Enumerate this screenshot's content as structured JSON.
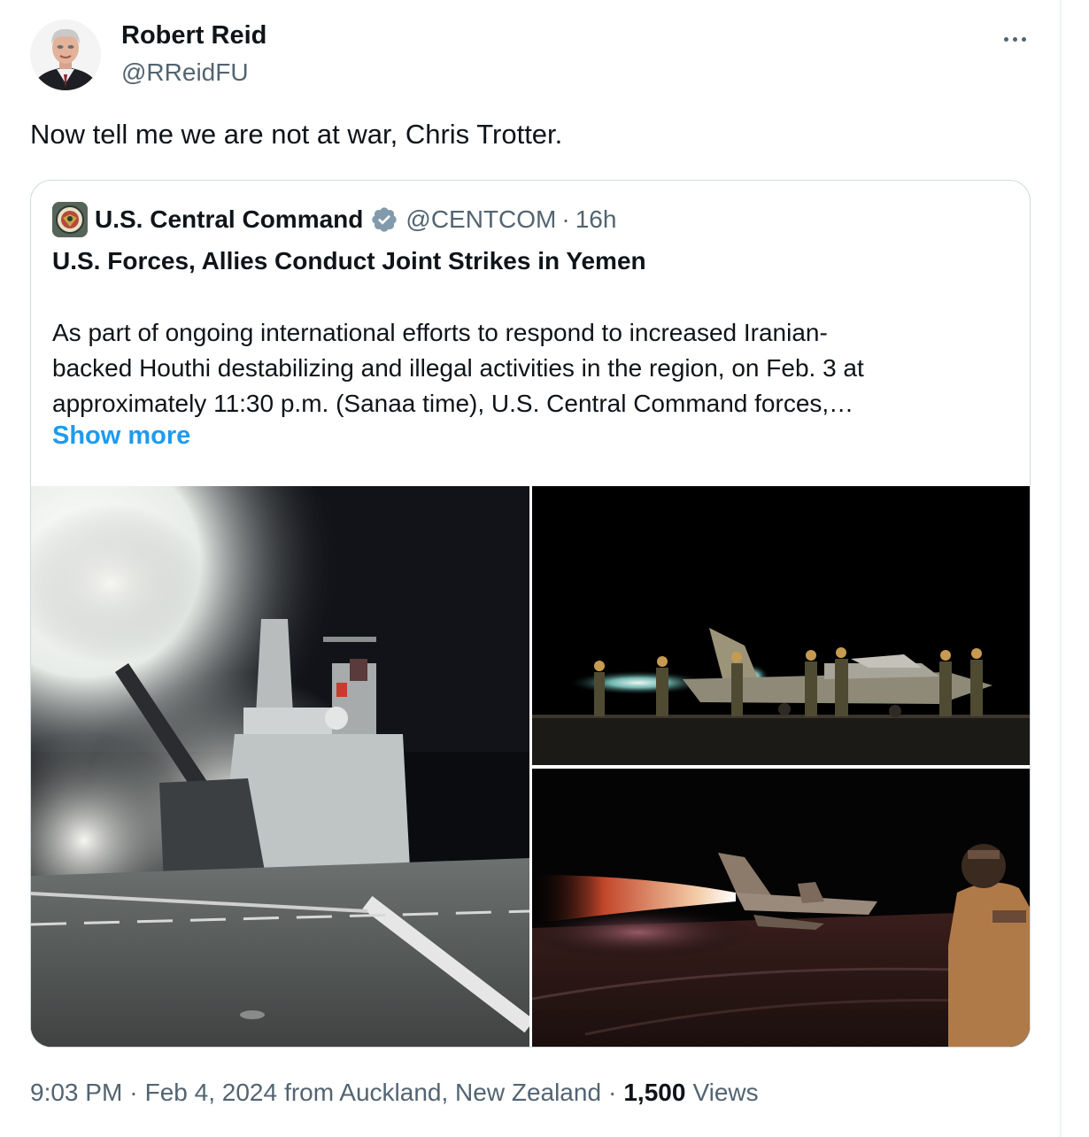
{
  "author": {
    "name": "Robert Reid",
    "handle": "@RReidFU"
  },
  "tweet": {
    "text": "Now tell me we are not at war, Chris Trotter."
  },
  "quote": {
    "name": "U.S. Central Command",
    "handle": "@CENTCOM",
    "separator": "·",
    "time": "16h",
    "title": "U.S. Forces, Allies Conduct Joint Strikes in Yemen",
    "body_lines": [
      "As part of ongoing international efforts to respond to increased Iranian-",
      "backed Houthi destabilizing and illegal activities in the region, on Feb. 3 at",
      "approximately 11:30 p.m. (Sanaa time), U.S. Central Command forces,…"
    ],
    "show_more": "Show more",
    "verified_icon": "verified-badge-icon",
    "verified_color": "#829aab"
  },
  "meta": {
    "time": "9:03 PM",
    "separator": "·",
    "date": "Feb 4, 2024",
    "location": "from Auckland, New Zealand",
    "views_count": "1,500",
    "views_label": "Views"
  },
  "colors": {
    "link": "#1d9bf0",
    "text_primary": "#0f1419",
    "text_secondary": "#536471",
    "border": "#cfd9de"
  }
}
